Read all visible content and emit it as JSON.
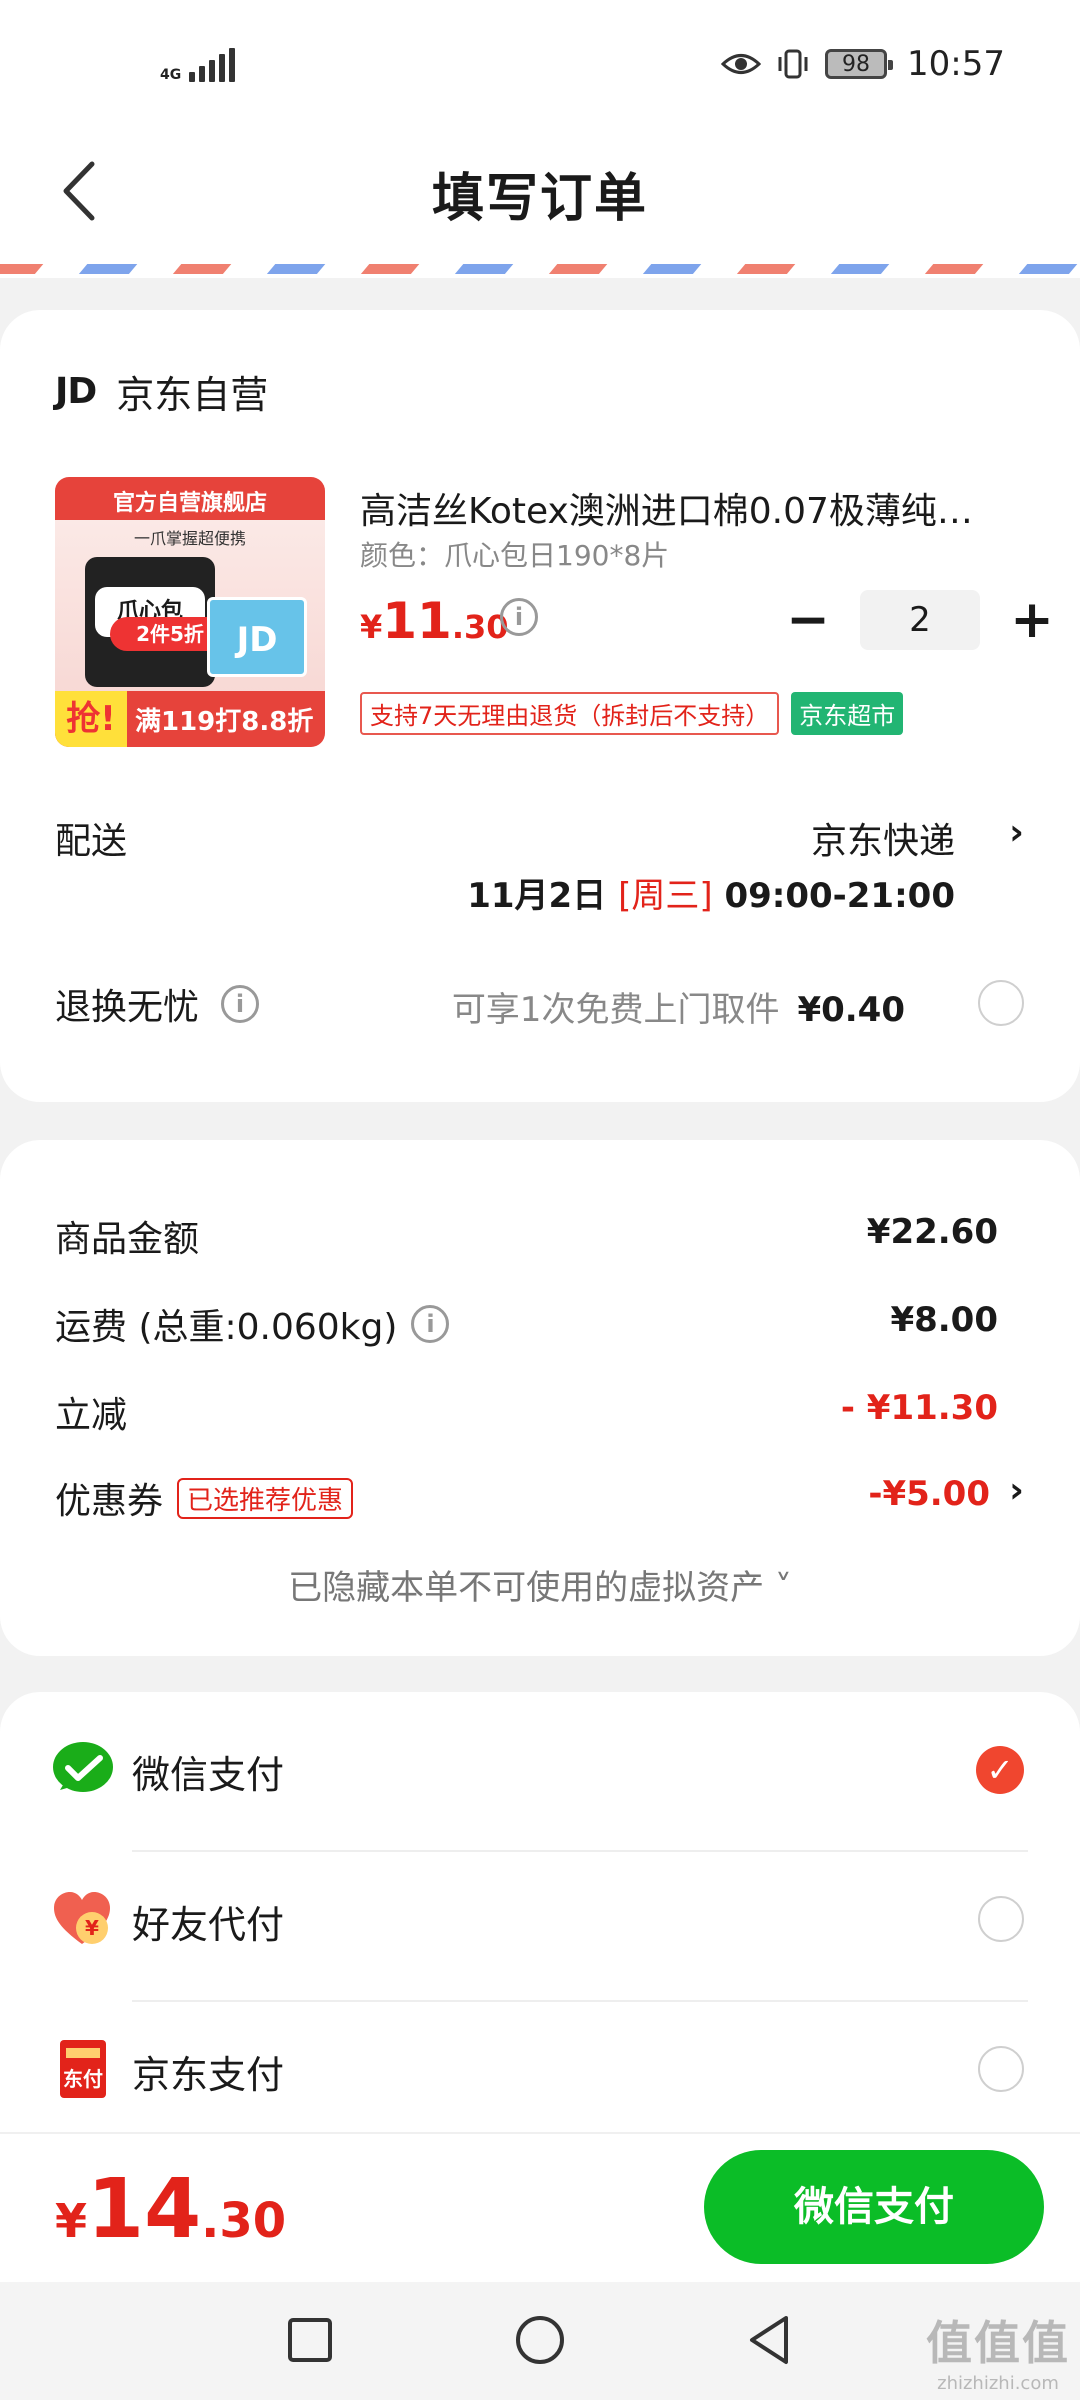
{
  "status_bar": {
    "network": "4G",
    "battery": "98",
    "time": "10:57"
  },
  "header": {
    "title": "填写订单"
  },
  "shop": {
    "logo_text": "JD",
    "name": "京东自营"
  },
  "product": {
    "image": {
      "banner": "官方自营旗舰店",
      "subtitle": "一爪掌握超便携",
      "pack_text": "爪心包",
      "deal": "2件5折",
      "card": "JD",
      "grab": "抢!",
      "promo": "满119打8.8折"
    },
    "name": "高洁丝Kotex澳洲进口棉0.07极薄纯…",
    "spec": "颜色：爪心包日190*8片",
    "price": {
      "currency": "¥",
      "integer": "11",
      "decimal": ".30"
    },
    "quantity": "2",
    "tags": {
      "return_policy": "支持7天无理由退货（拆封后不支持）",
      "store": "京东超市"
    }
  },
  "delivery": {
    "label": "配送",
    "carrier": "京东快递",
    "date": "11月2日",
    "weekday": "[周三]",
    "window": "09:00-21:00"
  },
  "return_service": {
    "label": "退换无忧",
    "desc": "可享1次免费上门取件",
    "price": "¥0.40"
  },
  "summary": {
    "goods_label": "商品金额",
    "goods_value": "¥22.60",
    "shipping_label": "运费 (总重:0.060kg)",
    "shipping_value": "¥8.00",
    "discount_label": "立减",
    "discount_value": "- ¥11.30",
    "coupon_label": "优惠券",
    "coupon_tag": "已选推荐优惠",
    "coupon_value": "-¥5.00",
    "hidden_note": "已隐藏本单不可使用的虚拟资产 ˅"
  },
  "payment": {
    "methods": [
      {
        "label": "微信支付",
        "selected": true
      },
      {
        "label": "好友代付",
        "selected": false
      },
      {
        "label": "京东支付",
        "selected": false
      }
    ]
  },
  "footer": {
    "total_currency": "¥",
    "total_integer": "14",
    "total_decimal": ".30",
    "pay_button": "微信支付"
  },
  "watermark": {
    "big": "值值值",
    "small": "zhizhizhi.com"
  },
  "colors": {
    "accent_red": "#e2231a",
    "wechat_green": "#0bbd27",
    "store_tag_green": "#22b573"
  }
}
